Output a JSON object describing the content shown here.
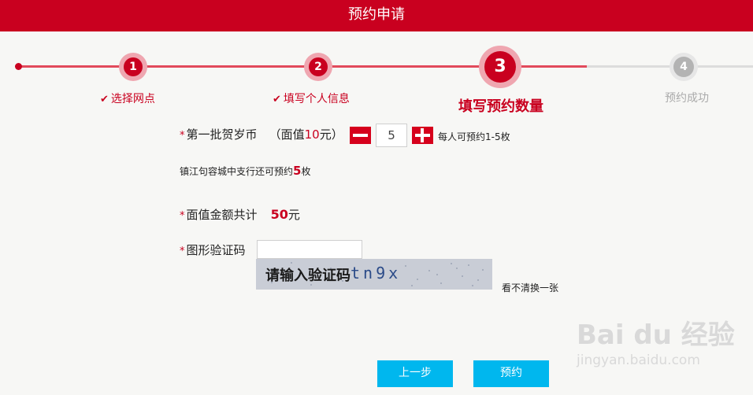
{
  "header": {
    "title": "预约申请"
  },
  "steps": [
    {
      "number": "1",
      "label": "选择网点",
      "state": "done"
    },
    {
      "number": "2",
      "label": "填写个人信息",
      "state": "done"
    },
    {
      "number": "3",
      "label": "填写预约数量",
      "state": "current"
    },
    {
      "number": "4",
      "label": "预约成功",
      "state": "pending"
    }
  ],
  "form": {
    "coin": {
      "label": "第一批贺岁币",
      "face_prefix": "（面值",
      "face_value": "10",
      "face_suffix": "元）",
      "quantity": "5",
      "limit_text": "每人可预约1-5枚"
    },
    "branch": {
      "text": "镇江句容城中支行还可预约",
      "count": "5",
      "unit": "枚"
    },
    "total": {
      "label": "面值金额共计",
      "amount": "50",
      "unit": "元"
    },
    "captcha": {
      "label": "图形验证码",
      "hint": "请输入验证码",
      "code": "tn9x",
      "refresh": "看不清换一张"
    }
  },
  "buttons": {
    "prev": "上一步",
    "submit": "预约"
  },
  "watermark": {
    "line1": "Bai du 经验",
    "line2": "jingyan.baidu.com"
  },
  "colors": {
    "primary": "#c9001f",
    "button": "#00b7ee"
  }
}
